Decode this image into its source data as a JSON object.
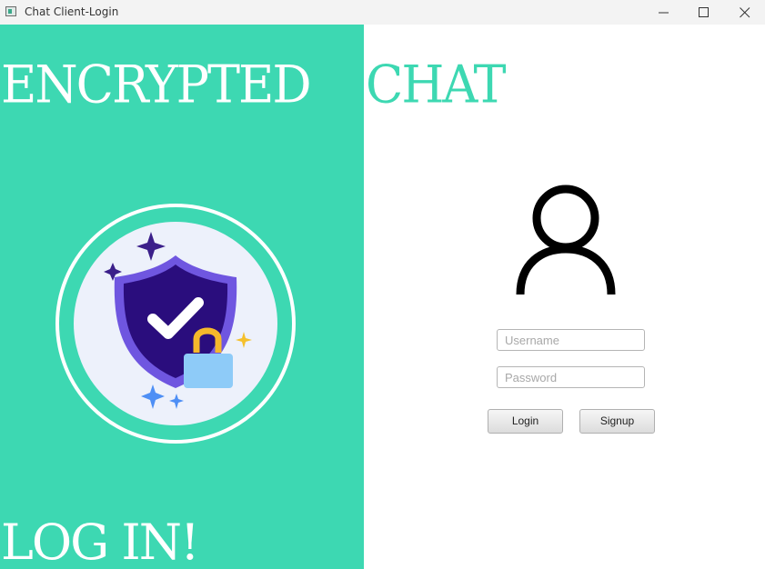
{
  "window": {
    "title": "Chat Client-Login",
    "icon": "app-window-icon"
  },
  "branding": {
    "headline_left": "ENCRYPTED",
    "headline_right": "CHAT",
    "cta": "LOG IN!",
    "accent_color": "#3dd8b2",
    "illustration": "shield-check-lock-icon"
  },
  "form": {
    "avatar_icon": "user-icon",
    "username_placeholder": "Username",
    "username_value": "",
    "password_placeholder": "Password",
    "password_value": "",
    "login_label": "Login",
    "signup_label": "Signup"
  }
}
